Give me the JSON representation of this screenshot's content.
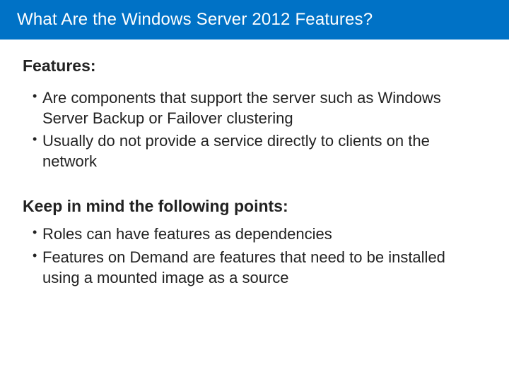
{
  "title": "What Are the Windows Server 2012 Features?",
  "section1": {
    "heading": "Features:",
    "items": [
      "Are components that support the server such as Windows Server Backup or Failover clustering",
      "Usually do not provide a service directly to clients on the network"
    ]
  },
  "section2": {
    "heading": "Keep in mind the following points:",
    "items": [
      "Roles can have features as dependencies",
      "Features on Demand are features that need to be installed using a mounted image as a source"
    ]
  }
}
